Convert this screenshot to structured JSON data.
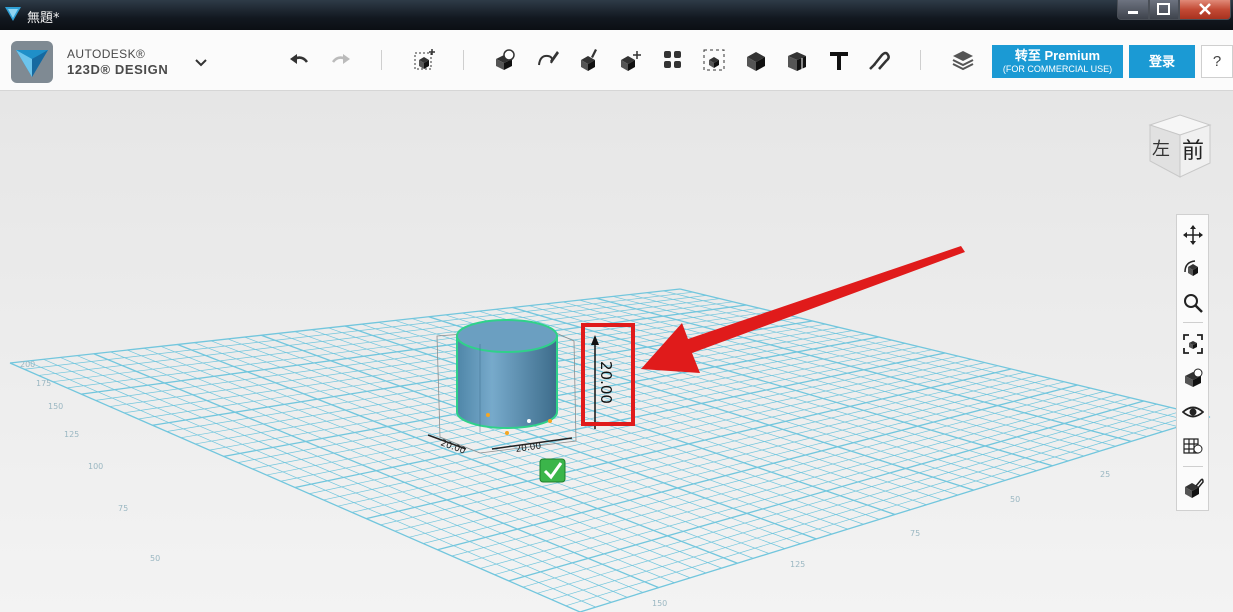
{
  "window": {
    "title": "無題*"
  },
  "brand": {
    "line1": "AUTODESK®",
    "line2": "123D® DESIGN"
  },
  "toolbar": {
    "undo": "undo-arrow-icon",
    "redo": "redo-arrow-icon",
    "tools": [
      "transform",
      "primitives",
      "sketch",
      "construct",
      "modify",
      "pattern",
      "grouping",
      "combine",
      "measure",
      "text",
      "snap",
      "material"
    ]
  },
  "premium": {
    "title": "转至 Premium",
    "subtitle": "(FOR COMMERCIAL USE)"
  },
  "login": {
    "label": "登录"
  },
  "help": {
    "label": "?"
  },
  "viewcube": {
    "left": "左",
    "front": "前"
  },
  "selection": {
    "height_value": "20.00",
    "dims": [
      "20.00",
      "20.00"
    ]
  },
  "grid_labels": [
    "50",
    "75",
    "100",
    "125",
    "150",
    "175",
    "200",
    "25",
    "50",
    "75",
    "125",
    "150"
  ],
  "colors": {
    "accent": "#1b9ad4",
    "cylinder": "#5f94b4",
    "grid": "#6fc3dc",
    "highlight": "#e01b1b",
    "selection": "#2fd18a"
  }
}
